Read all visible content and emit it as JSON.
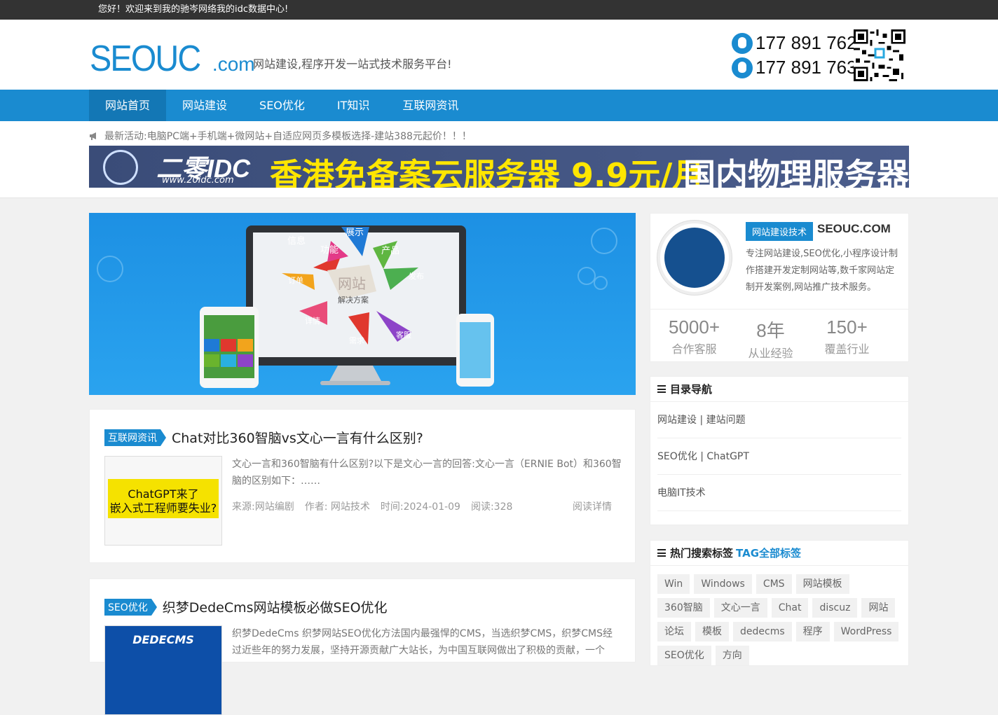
{
  "topbar": {
    "welcome": "您好！欢迎来到我的驰岑网络我的idc数据中心!"
  },
  "header": {
    "logo_main": "SEOUC",
    "logo_suffix": ".com",
    "slogan": "网站建设,程序开发一站式技术服务平台!",
    "phones": [
      "177 891 762",
      "177 891 763"
    ]
  },
  "nav": {
    "items": [
      "网站首页",
      "网站建设",
      "SEO优化",
      "IT知识",
      "互联网资讯"
    ]
  },
  "notice": {
    "text": "最新活动:电脑PC端+手机端+微网站+自适应网页多模板选择-建站388元起价！！！"
  },
  "banner": {
    "logo": "二零IDC",
    "logo_url_text": "www.20idc.com",
    "headline": "香港免备案云服务器 9.9元/月",
    "right": "国内物理服务器"
  },
  "hero": {
    "center_title": "网站",
    "center_sub": "解决方案",
    "labels": [
      "信息",
      "功能",
      "展示",
      "产品",
      "发布",
      "订单",
      "详情",
      "需求",
      "客服"
    ]
  },
  "posts": [
    {
      "category": "互联网资讯",
      "title": "Chat对比360智脑vs文心一言有什么区别?",
      "thumb_text_1": "ChatGPT来了",
      "thumb_text_2": "嵌入式工程师要失业?",
      "excerpt": "文心一言和360智脑有什么区别?以下是文心一言的回答:文心一言（ERNIE Bot）和360智脑的区别如下：……",
      "source": "来源:网站编剧",
      "author": "作者: 网站技术",
      "time": "时间:2024-01-09",
      "reads": "阅读:328",
      "more": "阅读详情"
    },
    {
      "category": "SEO优化",
      "title": "织梦DedeCms网站模板必做SEO优化",
      "thumb_text_1": "DEDECMS",
      "excerpt": "织梦DedeCms 织梦网站SEO优化方法国内最强悍的CMS，当选织梦CMS，织梦CMS经过近些年的努力发展，坚持开源贡献广大站长，为中国互联网做出了积极的贡献，一个"
    }
  ],
  "profile": {
    "tag": "网站建设技术",
    "name": "SEOUC.COM",
    "desc": "专注网站建设,SEO优化,小程序设计制作搭建开发定制网站等,数千家网站定制开发案例,网站推广技术服务。",
    "stats": [
      {
        "num": "5000+",
        "label": "合作客服"
      },
      {
        "num": "8年",
        "label": "从业经验"
      },
      {
        "num": "150+",
        "label": "覆盖行业"
      }
    ]
  },
  "dirnav": {
    "title": "目录导航",
    "items": [
      "网站建设 | 建站问题",
      "SEO优化 | ChatGPT",
      "电脑IT技术"
    ]
  },
  "tagbox": {
    "title": "热门搜索标签",
    "link": "TAG全部标签",
    "tags": [
      "Win",
      "Windows",
      "CMS",
      "网站模板",
      "360智脑",
      "文心一言",
      "Chat",
      "discuz",
      "网站",
      "论坛",
      "模板",
      "dedecms",
      "程序",
      "WordPress",
      "SEO优化",
      "方向"
    ]
  },
  "colors": {
    "accent": "#1a8bd0",
    "topbar": "#333333",
    "banner_yellow": "#ffe600"
  }
}
